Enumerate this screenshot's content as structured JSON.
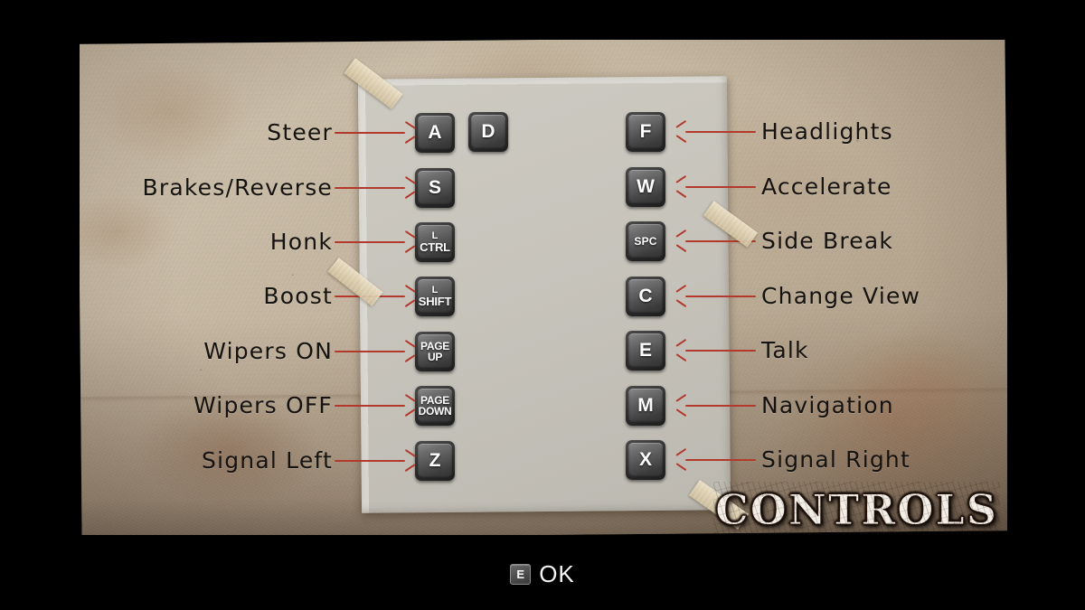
{
  "screen": {
    "title": "CONTROLS"
  },
  "panel": {
    "left_column": [
      {
        "label": "Steer",
        "keys": [
          {
            "top": "A"
          },
          {
            "top": "D"
          }
        ]
      },
      {
        "label": "Brakes/Reverse",
        "keys": [
          {
            "top": "S"
          }
        ]
      },
      {
        "label": "Honk",
        "keys": [
          {
            "top": "L",
            "bottom": "CTRL"
          }
        ]
      },
      {
        "label": "Boost",
        "keys": [
          {
            "top": "L",
            "bottom": "SHIFT"
          }
        ]
      },
      {
        "label": "Wipers ON",
        "keys": [
          {
            "top": "PAGE",
            "bottom": "UP"
          }
        ]
      },
      {
        "label": "Wipers OFF",
        "keys": [
          {
            "top": "PAGE",
            "bottom": "DOWN"
          }
        ]
      },
      {
        "label": "Signal Left",
        "keys": [
          {
            "top": "Z"
          }
        ]
      }
    ],
    "right_column": [
      {
        "label": "Headlights",
        "keys": [
          {
            "top": "F"
          }
        ]
      },
      {
        "label": "Accelerate",
        "keys": [
          {
            "top": "W"
          }
        ]
      },
      {
        "label": "Side Break",
        "keys": [
          {
            "top": "SPC"
          }
        ]
      },
      {
        "label": "Change View",
        "keys": [
          {
            "top": "C"
          }
        ]
      },
      {
        "label": "Talk",
        "keys": [
          {
            "top": "E"
          }
        ]
      },
      {
        "label": "Navigation",
        "keys": [
          {
            "top": "M"
          }
        ]
      },
      {
        "label": "Signal Right",
        "keys": [
          {
            "top": "X"
          }
        ]
      }
    ]
  },
  "prompt": {
    "key": "E",
    "action": "OK"
  },
  "colors": {
    "arrow": "#b2392c",
    "panel": "#c7c4bc",
    "paper": "#c8bba6",
    "key_face": "#515151",
    "label_text": "#15120f",
    "letterbox": "#000000"
  }
}
